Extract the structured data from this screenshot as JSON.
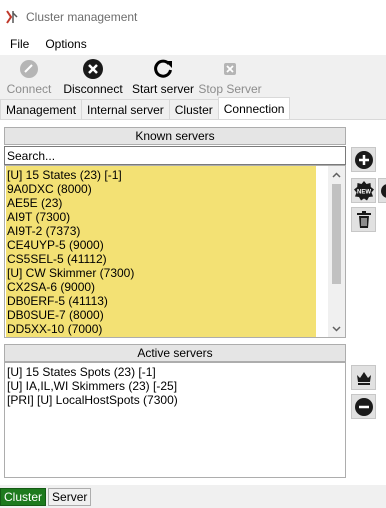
{
  "window": {
    "title": "Cluster management"
  },
  "menu": [
    "File",
    "Options"
  ],
  "toolbar": {
    "connect": "Connect",
    "disconnect": "Disconnect",
    "start_server": "Start server",
    "stop_server": "Stop Server"
  },
  "tabs": [
    "Management",
    "Internal server",
    "Cluster",
    "Connection"
  ],
  "active_tab": "Connection",
  "known_servers": {
    "header": "Known servers",
    "search_placeholder": "Search...",
    "items": [
      "[U] 15 States (23) [-1]",
      "9A0DXC (8000)",
      "AE5E (23)",
      "AI9T (7300)",
      "AI9T-2 (7373)",
      "CE4UYP-5 (9000)",
      "CS5SEL-5 (41112)",
      "[U] CW Skimmer (7300)",
      "CX2SA-6 (9000)",
      "DB0ERF-5 (41113)",
      "DB0SUE-7 (8000)",
      "DD5XX-10 (7000)"
    ]
  },
  "active_servers": {
    "header": "Active servers",
    "items": [
      "[U] 15 States Spots (23) [-1]",
      "[U] IA,IL,WI Skimmers (23) [-25]",
      "[PRI] [U] LocalHostSpots (7300)"
    ]
  },
  "side_buttons": {
    "new_badge": "NEW"
  },
  "status_tabs": [
    "Cluster",
    "Server"
  ],
  "colors": {
    "highlight": "#f3e174",
    "cluster_status_active": "#1e7a1e"
  }
}
